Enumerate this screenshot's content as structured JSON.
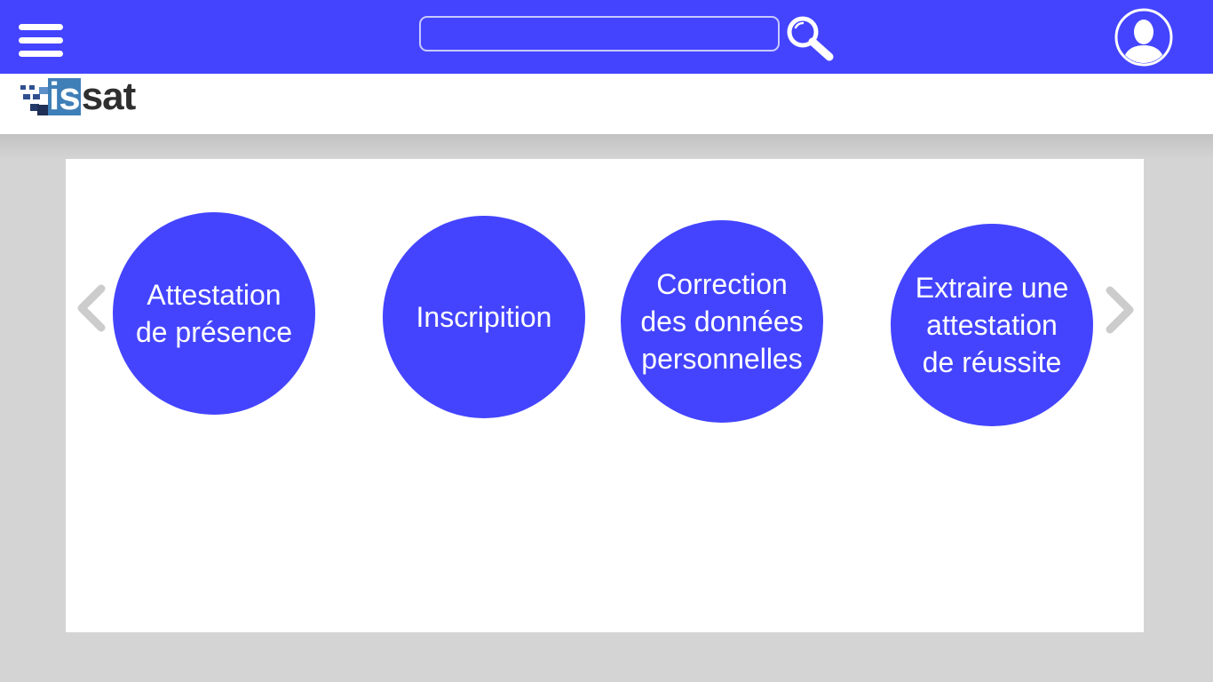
{
  "header": {
    "menu_icon": "hamburger-menu-icon",
    "search": {
      "value": "",
      "placeholder": "",
      "icon": "search-icon"
    },
    "user_icon": "user-avatar-icon"
  },
  "brand": {
    "logo_text_primary": "is",
    "logo_text_secondary": "sat"
  },
  "carousel": {
    "prev_icon": "chevron-left-icon",
    "next_icon": "chevron-right-icon",
    "items": [
      {
        "label": "Attestation\nde présence"
      },
      {
        "label": "Inscripition"
      },
      {
        "label": "Correction\ndes données\npersonnelles"
      },
      {
        "label": "Extraire une\nattestation\nde réussite"
      }
    ]
  },
  "colors": {
    "primary": "#4444ff",
    "background": "#d4d4d4",
    "panel": "#ffffff",
    "arrow": "#cccccc",
    "logo_blue": "#3f7fb8",
    "logo_dark": "#2f2f2f"
  }
}
